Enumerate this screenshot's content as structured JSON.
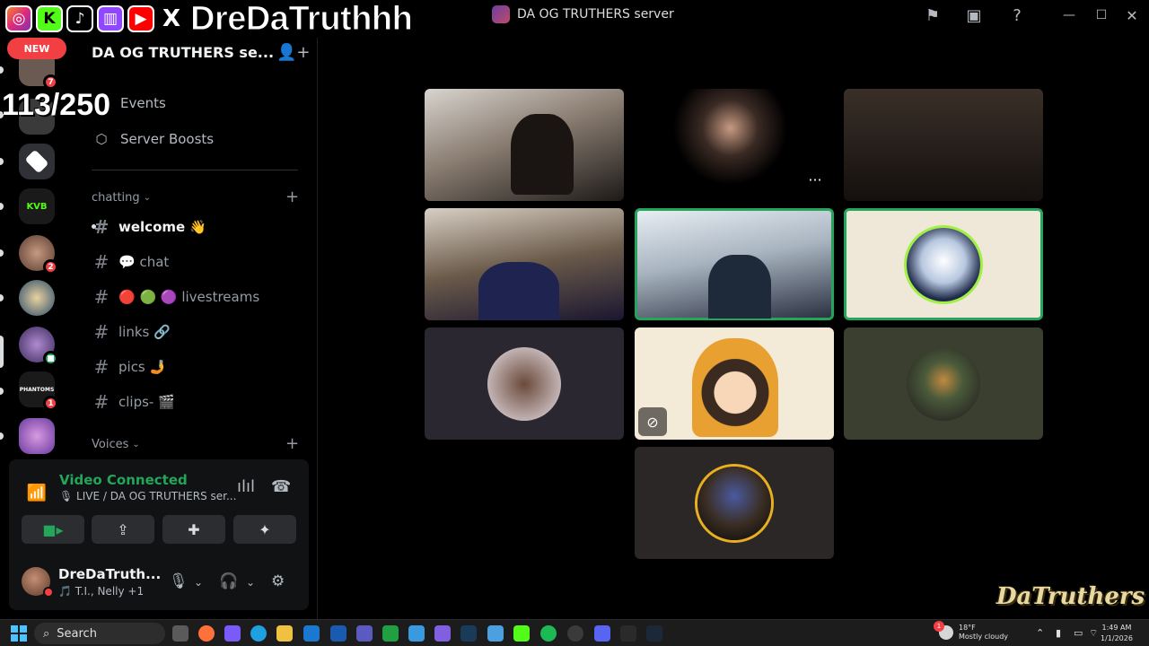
{
  "window": {
    "title": "DA OG TRUTHERS server"
  },
  "overlay": {
    "streamer_name": "DreDaTruthhh",
    "new_badge": "NEW",
    "counter": "113/250",
    "social_icons": [
      "instagram-icon",
      "kick-icon",
      "tiktok-icon",
      "twitch-icon",
      "youtube-icon",
      "x-icon"
    ]
  },
  "rail": {
    "servers": [
      {
        "name": "server-1",
        "badge": "7",
        "color": "#6a5a52"
      },
      {
        "name": "server-2",
        "badge": "",
        "color": "#3a3a3a"
      },
      {
        "name": "server-3",
        "badge": "",
        "color": "#2f3136"
      },
      {
        "name": "server-kvb",
        "badge": "",
        "color": "#1a1a1a"
      },
      {
        "name": "server-5",
        "badge": "2",
        "color": "#8a6a5a"
      },
      {
        "name": "server-6",
        "badge": "",
        "color": "#2a4a6a"
      },
      {
        "name": "server-7",
        "badge": "",
        "color": "#5a4a8a"
      },
      {
        "name": "server-phantoms",
        "badge": "1",
        "color": "#1a1a1a"
      },
      {
        "name": "server-9",
        "badge": "",
        "color": "#9a6ad0"
      }
    ]
  },
  "sidebar": {
    "server_name": "DA OG TRUTHERS se...",
    "nav": [
      {
        "label": "Events"
      },
      {
        "label": "Server Boosts"
      }
    ],
    "categories": [
      {
        "label": "chatting"
      },
      {
        "label": "Voices"
      }
    ],
    "channels": [
      {
        "label": "welcome 👋"
      },
      {
        "label": "💬 chat"
      },
      {
        "label": "🔴 🟢 🟣 livestreams"
      },
      {
        "label": "links 🔗"
      },
      {
        "label": "pics 🤳"
      },
      {
        "label": "clips- 🎬"
      }
    ]
  },
  "voice": {
    "status": "Video Connected",
    "channel": "🎙 LIVE / DA OG TRUTHERS ser..."
  },
  "user": {
    "name": "DreDaTruth...",
    "activity": "🎵 T.I., Nelly +1"
  },
  "stage": {
    "tiles": [
      {
        "name": "tile-1",
        "kind": "video",
        "speaking": false
      },
      {
        "name": "tile-2",
        "kind": "video",
        "speaking": false
      },
      {
        "name": "tile-3",
        "kind": "video",
        "speaking": false
      },
      {
        "name": "tile-4",
        "kind": "video",
        "speaking": false
      },
      {
        "name": "tile-5",
        "kind": "video",
        "speaking": true
      },
      {
        "name": "tile-6",
        "kind": "avatar",
        "speaking": true
      },
      {
        "name": "tile-7",
        "kind": "avatar",
        "speaking": false
      },
      {
        "name": "tile-8",
        "kind": "avatar",
        "speaking": false
      },
      {
        "name": "tile-9",
        "kind": "avatar",
        "speaking": false
      },
      {
        "name": "tile-10",
        "kind": "avatar",
        "speaking": false
      }
    ],
    "watermark": "DaTruthers"
  },
  "taskbar": {
    "search_label": "Search",
    "weather_temp": "18°F",
    "weather_desc": "Mostly cloudy",
    "weather_alert": "1",
    "time": "1:49 AM",
    "date": "1/1/2026"
  },
  "colors": {
    "accent_green": "#23a55a",
    "danger": "#f23f43",
    "background": "#000000"
  }
}
